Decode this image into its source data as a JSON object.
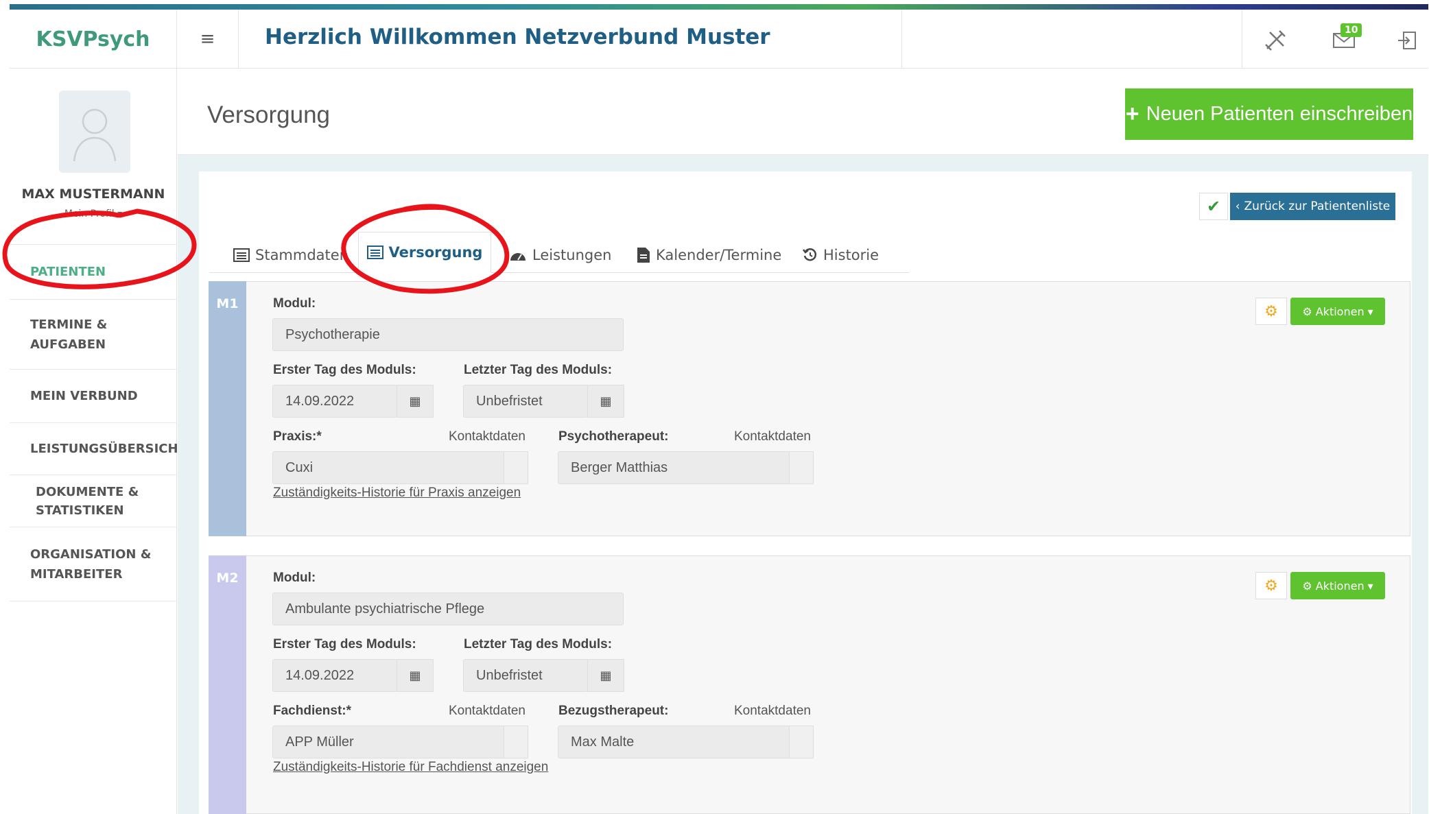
{
  "app": {
    "name": "KSVPsych",
    "welcome": "Herzlich Willkommen Netzverbund Muster",
    "mail_count": "10"
  },
  "user": {
    "name": "MAX MUSTERMANN",
    "profile_link": "Mein Profil"
  },
  "sidebar": {
    "items": [
      {
        "label": "PATIENTEN",
        "active": true
      },
      {
        "label_line1": "TERMINE &",
        "label_line2": "AUFGABEN"
      },
      {
        "label": "MEIN VERBUND"
      },
      {
        "label": "LEISTUNGSÜBERSICHT"
      },
      {
        "label_line1": "DOKUMENTE &",
        "label_line2": "STATISTIKEN"
      },
      {
        "label_line1": "ORGANISATION &",
        "label_line2": "MITARBEITER"
      }
    ]
  },
  "page": {
    "title": "Versorgung",
    "new_patient_button": "Neuen Patienten einschreiben",
    "back_button": "Zurück zur Patientenliste"
  },
  "tabs": [
    {
      "label": "Stammdaten"
    },
    {
      "label": "Versorgung",
      "active": true
    },
    {
      "label": "Leistungen"
    },
    {
      "label": "Kalender/Termine"
    },
    {
      "label": "Historie"
    }
  ],
  "modules": [
    {
      "tag": "M1",
      "modul_label": "Modul:",
      "modul_value": "Psychotherapie",
      "start_label": "Erster Tag des Moduls:",
      "start_value": "14.09.2022",
      "end_label": "Letzter Tag des Moduls:",
      "end_value": "Unbefristet",
      "left_label": "Praxis:*",
      "left_contact": "Kontaktdaten",
      "left_value": "Cuxi",
      "right_label": "Psychotherapeut:",
      "right_contact": "Kontaktdaten",
      "right_value": "Berger Matthias",
      "history_link": "Zuständigkeits-Historie für Praxis anzeigen",
      "actions_label": "Aktionen",
      "strip_color": "#a9c1da"
    },
    {
      "tag": "M2",
      "modul_label": "Modul:",
      "modul_value": "Ambulante psychiatrische Pflege",
      "start_label": "Erster Tag des Moduls:",
      "start_value": "14.09.2022",
      "end_label": "Letzter Tag des Moduls:",
      "end_value": "Unbefristet",
      "left_label": "Fachdienst:*",
      "left_contact": "Kontaktdaten",
      "left_value": "APP Müller",
      "right_label": "Bezugstherapeut:",
      "right_contact": "Kontaktdaten",
      "right_value": "Max Malte",
      "history_link": "Zuständigkeits-Historie für Fachdienst anzeigen",
      "actions_label": "Aktionen",
      "strip_color": "#c9c9ee"
    }
  ],
  "colors": {
    "brand_green": "#5fc22f",
    "title_blue": "#1f5f86",
    "annotation_red": "#e8141c"
  }
}
